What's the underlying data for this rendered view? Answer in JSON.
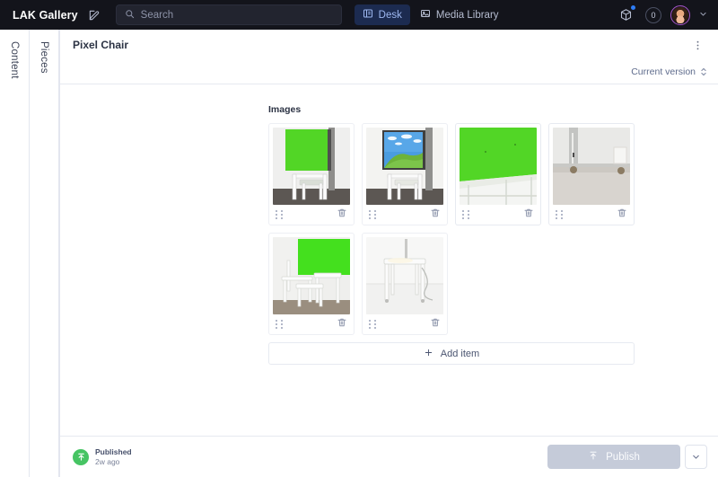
{
  "navbar": {
    "brand": "LAK Gallery",
    "compose_icon": "edit-square-icon",
    "search": {
      "icon": "search-icon",
      "placeholder": "Search",
      "value": ""
    },
    "tabs": [
      {
        "label": "Desk",
        "icon": "desk-icon",
        "active": true
      },
      {
        "label": "Media Library",
        "icon": "media-library-icon",
        "active": false
      }
    ],
    "right": {
      "package_icon": "package-cube-icon",
      "package_badge": true,
      "counter_icon": "presence-counter-icon",
      "counter_value": "0",
      "avatar": "user-avatar",
      "caret": "chevron-down-icon"
    }
  },
  "rails": [
    {
      "label": "Content"
    },
    {
      "label": "Pieces"
    }
  ],
  "document": {
    "title": "Pixel Chair",
    "menu_icon": "kebab-menu-icon",
    "version_label": "Current version",
    "version_caret": "chevron-up-down-icon"
  },
  "images_field": {
    "label": "Images",
    "add_item_label": "Add item",
    "add_item_icon": "plus-icon",
    "drag_icon": "drag-handle-icon",
    "delete_icon": "trash-icon",
    "items": [
      {
        "alt": "white chair in front of large green screen",
        "style": "green-screen-chair",
        "selected": false
      },
      {
        "alt": "white chair in front of screen showing blue sky and green hill wallpaper",
        "style": "bliss-wallpaper-chair",
        "selected": false
      },
      {
        "alt": "close-up of green screen panel on white frame",
        "style": "green-panel-closeup",
        "selected": true
      },
      {
        "alt": "white floor and metal legs against pale wall",
        "style": "floor-legs",
        "selected": true
      },
      {
        "alt": "white chairs stacked in front of green screen",
        "style": "stacked-chairs-green",
        "selected": false
      },
      {
        "alt": "white table with cable on white floor",
        "style": "white-table-cable",
        "selected": false
      }
    ]
  },
  "footer": {
    "status_icon": "published-up-arrow-icon",
    "status_label": "Published",
    "status_time": "2w ago",
    "publish_label": "Publish",
    "publish_icon": "publish-arrow-icon",
    "publish_disabled": true,
    "publish_menu_icon": "chevron-down-icon"
  },
  "colors": {
    "navbar_bg": "#13141b",
    "tab_active_bg": "#1c2b50",
    "tab_active_text": "#9db7f0",
    "accent_badge": "#2e7df6",
    "avatar_ring": "#a855c9",
    "published_green": "#46c463",
    "publish_disabled_bg": "#c5cbd9",
    "card_selected_border": "#dcdfe8"
  }
}
